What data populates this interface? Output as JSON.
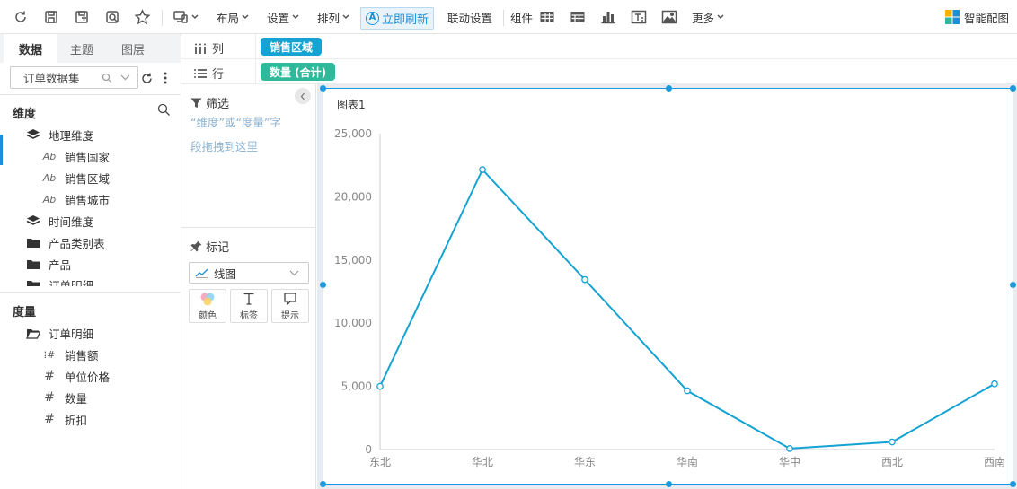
{
  "toolbar": {
    "layout": "布局",
    "settings": "设置",
    "sort": "排列",
    "refresh_now": "立即刷新",
    "link_settings": "联动设置",
    "components": "组件",
    "more": "更多",
    "smart_chart": "智能配图"
  },
  "left_tabs": [
    "数据",
    "主题",
    "图层"
  ],
  "dataset": {
    "selected": "订单数据集"
  },
  "dimensions": {
    "heading": "维度",
    "items": [
      {
        "label": "地理维度",
        "icon": "layers-icon",
        "level": 0
      },
      {
        "label": "销售国家",
        "icon": "text-field-icon",
        "level": 1
      },
      {
        "label": "销售区域",
        "icon": "text-field-icon",
        "level": 1
      },
      {
        "label": "销售城市",
        "icon": "text-field-icon",
        "level": 1
      },
      {
        "label": "时间维度",
        "icon": "layers-icon",
        "level": 0
      },
      {
        "label": "产品类别表",
        "icon": "folder-icon",
        "level": 0
      },
      {
        "label": "产品",
        "icon": "folder-icon",
        "level": 0
      },
      {
        "label": "订单明细",
        "icon": "folder-icon",
        "level": 0
      }
    ]
  },
  "measures": {
    "heading": "度量",
    "items": [
      {
        "label": "订单明细",
        "icon": "folder-open-icon",
        "level": 0
      },
      {
        "label": "销售额",
        "icon": "calc-field-icon",
        "level": 1
      },
      {
        "label": "单位价格",
        "icon": "number-field-icon",
        "level": 1
      },
      {
        "label": "数量",
        "icon": "number-field-icon",
        "level": 1
      },
      {
        "label": "折扣",
        "icon": "number-field-icon",
        "level": 1
      }
    ]
  },
  "shelves": {
    "columns_label": "列",
    "rows_label": "行",
    "column_pill": "销售区域",
    "row_pill": "数量 (合计)"
  },
  "filter": {
    "title": "筛选",
    "hint": "“维度”或“度量”字",
    "hint_end": "段拖拽到这里"
  },
  "marks": {
    "title": "标记",
    "chart_type": "线图",
    "buttons": [
      "颜色",
      "标签",
      "提示"
    ]
  },
  "chart_data": {
    "type": "line",
    "title": "图表1",
    "categories": [
      "东北",
      "华北",
      "华东",
      "华南",
      "华中",
      "西北",
      "西南"
    ],
    "values": [
      5000,
      22150,
      13450,
      4650,
      80,
      600,
      5200
    ],
    "ylim": [
      0,
      25000
    ],
    "yticks": [
      "0",
      "5,000",
      "10,000",
      "15,000",
      "20,000",
      "25,000"
    ],
    "grid": false,
    "color": "#14a3d2"
  }
}
